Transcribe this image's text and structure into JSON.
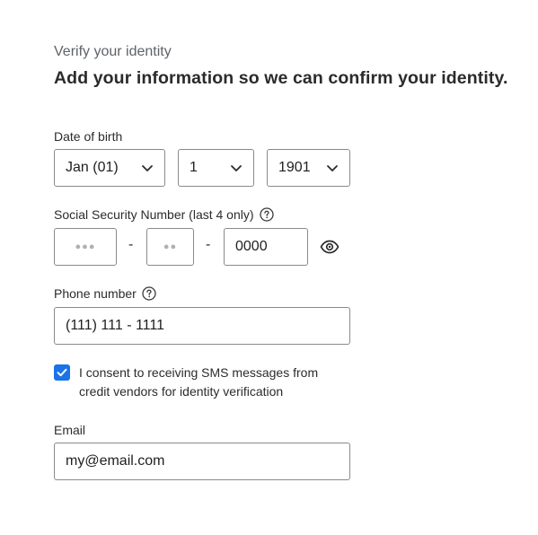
{
  "header": {
    "subtitle": "Verify your identity",
    "headline": "Add your information so we can confirm your identity."
  },
  "dob": {
    "label": "Date of birth",
    "month": "Jan (01)",
    "day": "1",
    "year": "1901"
  },
  "ssn": {
    "label": "Social Security Number (last 4 only)",
    "part1_mask": "●●●",
    "separator": "-",
    "part2_mask": "●●",
    "last4": "0000"
  },
  "phone": {
    "label": "Phone number",
    "value": "(111) 111 - 1111"
  },
  "consent": {
    "checked": true,
    "line1": "I consent to receiving SMS messages from",
    "line2": "credit vendors for identity verification"
  },
  "email": {
    "label": "Email",
    "value": "my@email.com"
  },
  "colors": {
    "accent": "#1a73e8",
    "border": "#8a8a8a",
    "muted_text": "#5f6368"
  },
  "icons": {
    "help": "question-circle-icon",
    "reveal": "eye-icon",
    "dropdown": "chevron-down-icon",
    "check": "checkmark-icon"
  }
}
